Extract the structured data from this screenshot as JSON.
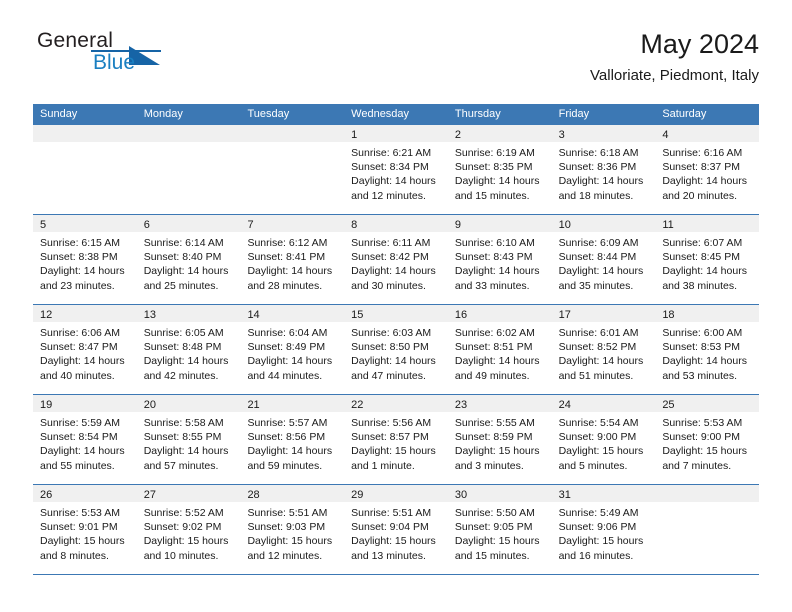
{
  "brand": {
    "word_one": "General",
    "word_two": "Blue",
    "accent_color": "#1664a6",
    "blue_text_color": "#1a7fc1"
  },
  "header": {
    "title": "May 2024",
    "subtitle": "Valloriate, Piedmont, Italy",
    "header_bar_color": "#3c78b4",
    "date_strip_color": "#f0f0f0"
  },
  "calendar": {
    "weekday_headers": [
      "Sunday",
      "Monday",
      "Tuesday",
      "Wednesday",
      "Thursday",
      "Friday",
      "Saturday"
    ],
    "weeks": [
      [
        {
          "day": "",
          "lines": []
        },
        {
          "day": "",
          "lines": []
        },
        {
          "day": "",
          "lines": []
        },
        {
          "day": "1",
          "lines": [
            "Sunrise: 6:21 AM",
            "Sunset: 8:34 PM",
            "Daylight: 14 hours",
            "and 12 minutes."
          ]
        },
        {
          "day": "2",
          "lines": [
            "Sunrise: 6:19 AM",
            "Sunset: 8:35 PM",
            "Daylight: 14 hours",
            "and 15 minutes."
          ]
        },
        {
          "day": "3",
          "lines": [
            "Sunrise: 6:18 AM",
            "Sunset: 8:36 PM",
            "Daylight: 14 hours",
            "and 18 minutes."
          ]
        },
        {
          "day": "4",
          "lines": [
            "Sunrise: 6:16 AM",
            "Sunset: 8:37 PM",
            "Daylight: 14 hours",
            "and 20 minutes."
          ]
        }
      ],
      [
        {
          "day": "5",
          "lines": [
            "Sunrise: 6:15 AM",
            "Sunset: 8:38 PM",
            "Daylight: 14 hours",
            "and 23 minutes."
          ]
        },
        {
          "day": "6",
          "lines": [
            "Sunrise: 6:14 AM",
            "Sunset: 8:40 PM",
            "Daylight: 14 hours",
            "and 25 minutes."
          ]
        },
        {
          "day": "7",
          "lines": [
            "Sunrise: 6:12 AM",
            "Sunset: 8:41 PM",
            "Daylight: 14 hours",
            "and 28 minutes."
          ]
        },
        {
          "day": "8",
          "lines": [
            "Sunrise: 6:11 AM",
            "Sunset: 8:42 PM",
            "Daylight: 14 hours",
            "and 30 minutes."
          ]
        },
        {
          "day": "9",
          "lines": [
            "Sunrise: 6:10 AM",
            "Sunset: 8:43 PM",
            "Daylight: 14 hours",
            "and 33 minutes."
          ]
        },
        {
          "day": "10",
          "lines": [
            "Sunrise: 6:09 AM",
            "Sunset: 8:44 PM",
            "Daylight: 14 hours",
            "and 35 minutes."
          ]
        },
        {
          "day": "11",
          "lines": [
            "Sunrise: 6:07 AM",
            "Sunset: 8:45 PM",
            "Daylight: 14 hours",
            "and 38 minutes."
          ]
        }
      ],
      [
        {
          "day": "12",
          "lines": [
            "Sunrise: 6:06 AM",
            "Sunset: 8:47 PM",
            "Daylight: 14 hours",
            "and 40 minutes."
          ]
        },
        {
          "day": "13",
          "lines": [
            "Sunrise: 6:05 AM",
            "Sunset: 8:48 PM",
            "Daylight: 14 hours",
            "and 42 minutes."
          ]
        },
        {
          "day": "14",
          "lines": [
            "Sunrise: 6:04 AM",
            "Sunset: 8:49 PM",
            "Daylight: 14 hours",
            "and 44 minutes."
          ]
        },
        {
          "day": "15",
          "lines": [
            "Sunrise: 6:03 AM",
            "Sunset: 8:50 PM",
            "Daylight: 14 hours",
            "and 47 minutes."
          ]
        },
        {
          "day": "16",
          "lines": [
            "Sunrise: 6:02 AM",
            "Sunset: 8:51 PM",
            "Daylight: 14 hours",
            "and 49 minutes."
          ]
        },
        {
          "day": "17",
          "lines": [
            "Sunrise: 6:01 AM",
            "Sunset: 8:52 PM",
            "Daylight: 14 hours",
            "and 51 minutes."
          ]
        },
        {
          "day": "18",
          "lines": [
            "Sunrise: 6:00 AM",
            "Sunset: 8:53 PM",
            "Daylight: 14 hours",
            "and 53 minutes."
          ]
        }
      ],
      [
        {
          "day": "19",
          "lines": [
            "Sunrise: 5:59 AM",
            "Sunset: 8:54 PM",
            "Daylight: 14 hours",
            "and 55 minutes."
          ]
        },
        {
          "day": "20",
          "lines": [
            "Sunrise: 5:58 AM",
            "Sunset: 8:55 PM",
            "Daylight: 14 hours",
            "and 57 minutes."
          ]
        },
        {
          "day": "21",
          "lines": [
            "Sunrise: 5:57 AM",
            "Sunset: 8:56 PM",
            "Daylight: 14 hours",
            "and 59 minutes."
          ]
        },
        {
          "day": "22",
          "lines": [
            "Sunrise: 5:56 AM",
            "Sunset: 8:57 PM",
            "Daylight: 15 hours",
            "and 1 minute."
          ]
        },
        {
          "day": "23",
          "lines": [
            "Sunrise: 5:55 AM",
            "Sunset: 8:59 PM",
            "Daylight: 15 hours",
            "and 3 minutes."
          ]
        },
        {
          "day": "24",
          "lines": [
            "Sunrise: 5:54 AM",
            "Sunset: 9:00 PM",
            "Daylight: 15 hours",
            "and 5 minutes."
          ]
        },
        {
          "day": "25",
          "lines": [
            "Sunrise: 5:53 AM",
            "Sunset: 9:00 PM",
            "Daylight: 15 hours",
            "and 7 minutes."
          ]
        }
      ],
      [
        {
          "day": "26",
          "lines": [
            "Sunrise: 5:53 AM",
            "Sunset: 9:01 PM",
            "Daylight: 15 hours",
            "and 8 minutes."
          ]
        },
        {
          "day": "27",
          "lines": [
            "Sunrise: 5:52 AM",
            "Sunset: 9:02 PM",
            "Daylight: 15 hours",
            "and 10 minutes."
          ]
        },
        {
          "day": "28",
          "lines": [
            "Sunrise: 5:51 AM",
            "Sunset: 9:03 PM",
            "Daylight: 15 hours",
            "and 12 minutes."
          ]
        },
        {
          "day": "29",
          "lines": [
            "Sunrise: 5:51 AM",
            "Sunset: 9:04 PM",
            "Daylight: 15 hours",
            "and 13 minutes."
          ]
        },
        {
          "day": "30",
          "lines": [
            "Sunrise: 5:50 AM",
            "Sunset: 9:05 PM",
            "Daylight: 15 hours",
            "and 15 minutes."
          ]
        },
        {
          "day": "31",
          "lines": [
            "Sunrise: 5:49 AM",
            "Sunset: 9:06 PM",
            "Daylight: 15 hours",
            "and 16 minutes."
          ]
        },
        {
          "day": "",
          "lines": []
        }
      ]
    ]
  }
}
